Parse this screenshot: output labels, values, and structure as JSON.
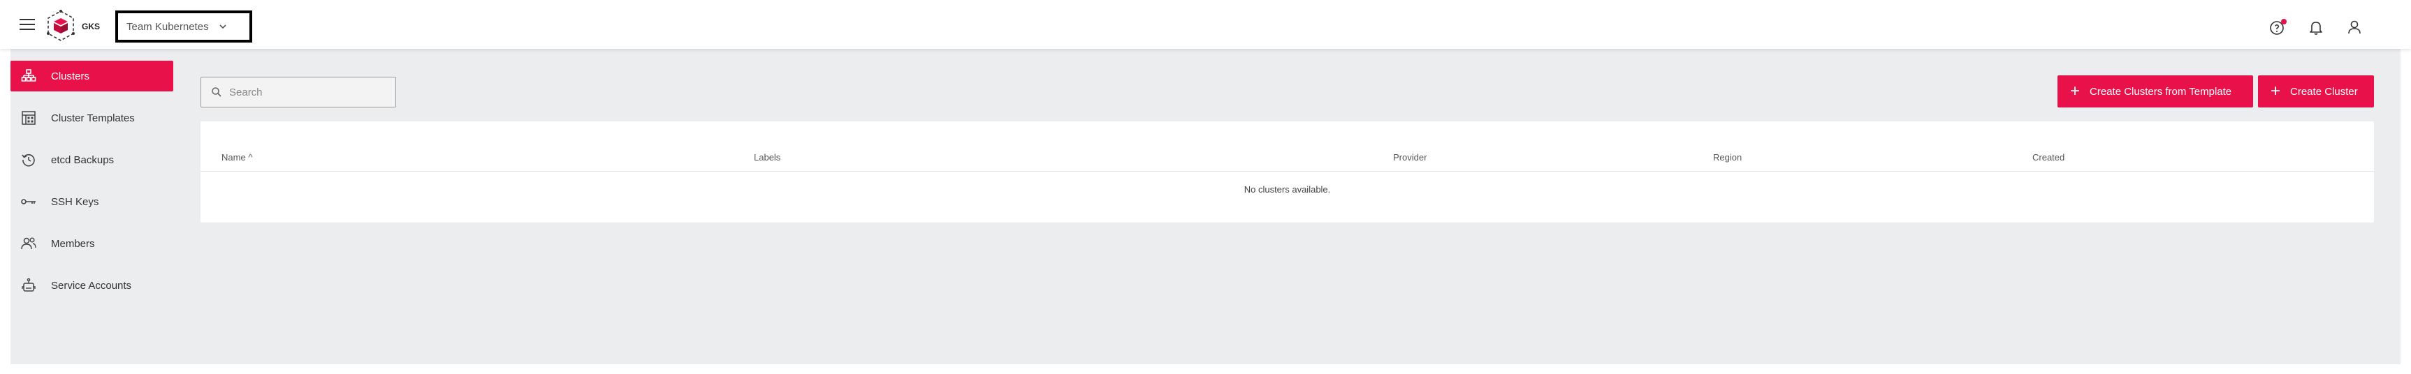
{
  "header": {
    "logo_text": "GKS",
    "project_select": {
      "value": "Team Kubernetes"
    },
    "accent_color": "#e8114a"
  },
  "sidebar": {
    "items": [
      {
        "label": "Clusters",
        "icon": "clusters-icon",
        "active": true
      },
      {
        "label": "Cluster Templates",
        "icon": "cluster-templates-icon",
        "active": false
      },
      {
        "label": "etcd Backups",
        "icon": "history-icon",
        "active": false
      },
      {
        "label": "SSH Keys",
        "icon": "key-icon",
        "active": false
      },
      {
        "label": "Members",
        "icon": "members-icon",
        "active": false
      },
      {
        "label": "Service Accounts",
        "icon": "robot-icon",
        "active": false
      }
    ]
  },
  "toolbar": {
    "search": {
      "placeholder": "Search",
      "value": ""
    },
    "create_from_template_label": "Create Clusters from Template",
    "create_cluster_label": "Create Cluster"
  },
  "table": {
    "columns": [
      "Name",
      "Labels",
      "Provider",
      "Region",
      "Created"
    ],
    "sort_indicator": "^",
    "empty_message": "No clusters available."
  }
}
